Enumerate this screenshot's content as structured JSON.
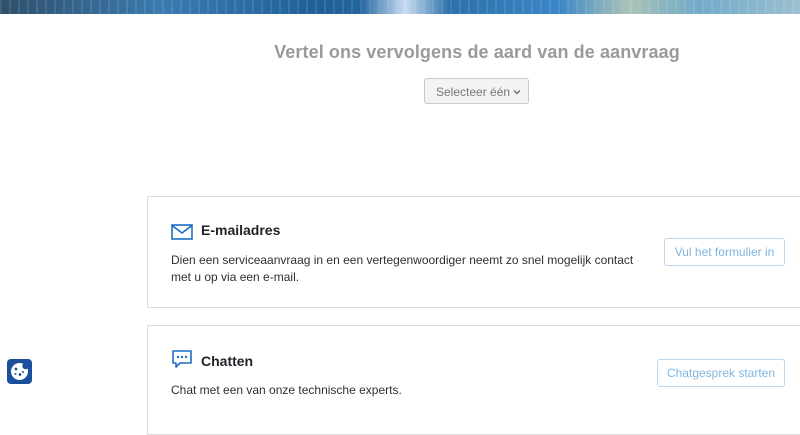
{
  "request": {
    "title": "Vertel ons vervolgens de aard van de aanvraag",
    "select_value": "Selecteer één"
  },
  "cards": {
    "email": {
      "icon": "envelope-icon",
      "title": "E-mailadres",
      "description_line1": "Dien een serviceaanvraag in en een vertegenwoordiger neemt zo snel mogelijk contact",
      "description_line2": "met u op via een e-mail.",
      "button_label": "Vul het formulier in"
    },
    "chat": {
      "icon": "chat-bubble-icon",
      "title": "Chatten",
      "description": "Chat met een van onze technische experts.",
      "button_label": "Chatgesprek starten"
    }
  },
  "cookie": {
    "icon": "cookie-icon"
  },
  "colors": {
    "accent_blue": "#1a6fc4",
    "button_border": "#b9d8f0",
    "button_text": "#7fb6e1",
    "title_gray": "#9a9a9a"
  }
}
